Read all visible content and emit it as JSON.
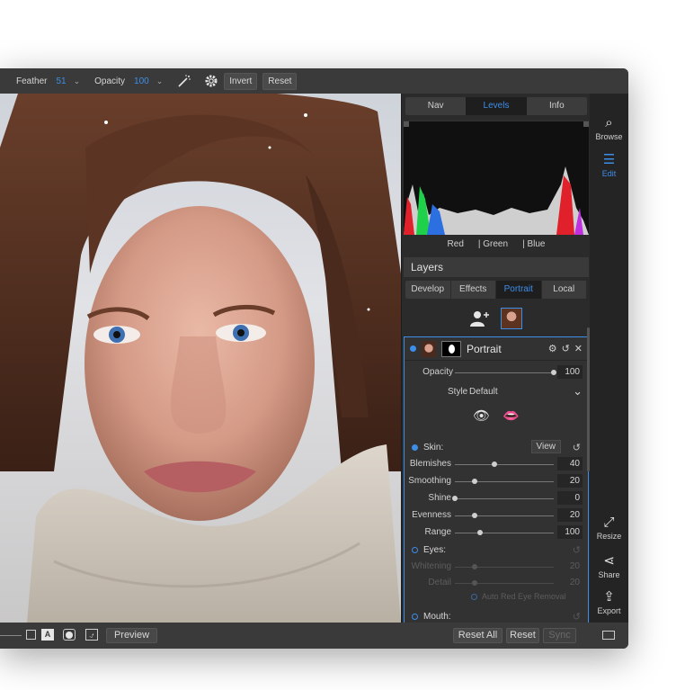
{
  "toolbar": {
    "feather_label": "Feather",
    "feather_value": "51",
    "opacity_label": "Opacity",
    "opacity_value": "100",
    "invert_label": "Invert",
    "reset_label": "Reset",
    "chevron": "⌄"
  },
  "panel": {
    "top_tabs": [
      {
        "label": "Nav"
      },
      {
        "label": "Levels"
      },
      {
        "label": "Info"
      }
    ],
    "active_top_tab": "Levels",
    "histogram_legend": [
      "Red",
      "| Green",
      "| Blue"
    ],
    "layers_title": "Layers",
    "layer_tabs": [
      {
        "label": "Develop"
      },
      {
        "label": "Effects"
      },
      {
        "label": "Portrait"
      },
      {
        "label": "Local"
      }
    ],
    "active_layer_tab": "Portrait",
    "portrait": {
      "title": "Portrait",
      "opacity_label": "Opacity",
      "opacity_value": "100",
      "opacity_fraction": 1.0,
      "style_label": "Style",
      "style_value": "Default",
      "skin_label": "Skin:",
      "view_label": "View",
      "skin_sliders": [
        {
          "label": "Blemishes",
          "value": "40",
          "fraction": 0.4
        },
        {
          "label": "Smoothing",
          "value": "20",
          "fraction": 0.2
        },
        {
          "label": "Shine",
          "value": "0",
          "fraction": 0.0
        },
        {
          "label": "Evenness",
          "value": "20",
          "fraction": 0.2
        },
        {
          "label": "Range",
          "value": "100",
          "fraction": 0.25
        }
      ],
      "eyes_label": "Eyes:",
      "eye_sliders": [
        {
          "label": "Whitening",
          "value": "20",
          "fraction": 0.2
        },
        {
          "label": "Detail",
          "value": "20",
          "fraction": 0.2
        }
      ],
      "auto_red_eye_label": "Auto Red Eye Removal",
      "mouth_label": "Mouth:"
    }
  },
  "rail": {
    "browse_label": "Browse",
    "edit_label": "Edit",
    "resize_label": "Resize",
    "share_label": "Share",
    "export_label": "Export"
  },
  "bottom": {
    "preview_label": "Preview",
    "reset_all_label": "Reset All",
    "reset_label": "Reset",
    "sync_label": "Sync",
    "text_icon_glyph": "A"
  },
  "colors": {
    "accent": "#3d8ee8",
    "panel_bg": "#2b2b2b",
    "toolbar_bg": "#3a3a3a"
  }
}
